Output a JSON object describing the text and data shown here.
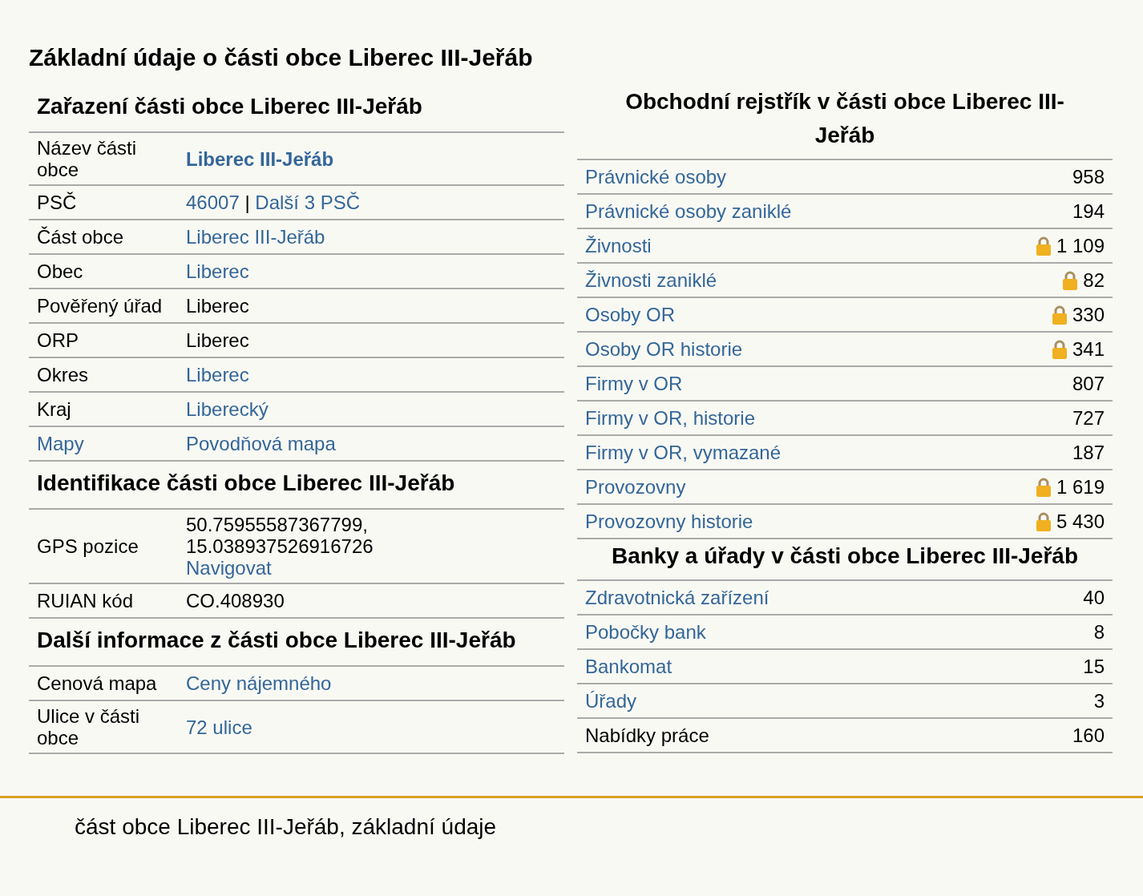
{
  "title": "Základní údaje o části obce Liberec III-Jeřáb",
  "left_sections": [
    {
      "title": "Zařazení části obce Liberec III-Jeřáb",
      "rows": [
        {
          "label": "Název části obce",
          "label_link": false,
          "lines": [
            [
              {
                "text": "Liberec III-Jeřáb",
                "link": true,
                "bold": true
              }
            ]
          ]
        },
        {
          "label": "PSČ",
          "label_link": false,
          "lines": [
            [
              {
                "text": "46007",
                "link": true,
                "bold": false
              },
              {
                "text": " | ",
                "link": false,
                "bold": false
              },
              {
                "text": "Další 3 PSČ",
                "link": true,
                "bold": false
              }
            ]
          ]
        },
        {
          "label": "Část obce",
          "label_link": false,
          "lines": [
            [
              {
                "text": "Liberec III-Jeřáb",
                "link": true,
                "bold": false
              }
            ]
          ]
        },
        {
          "label": "Obec",
          "label_link": false,
          "lines": [
            [
              {
                "text": "Liberec",
                "link": true,
                "bold": false
              }
            ]
          ]
        },
        {
          "label": "Pověřený úřad",
          "label_link": false,
          "lines": [
            [
              {
                "text": "Liberec",
                "link": false,
                "bold": false
              }
            ]
          ]
        },
        {
          "label": "ORP",
          "label_link": false,
          "lines": [
            [
              {
                "text": "Liberec",
                "link": false,
                "bold": false
              }
            ]
          ]
        },
        {
          "label": "Okres",
          "label_link": false,
          "lines": [
            [
              {
                "text": "Liberec",
                "link": true,
                "bold": false
              }
            ]
          ]
        },
        {
          "label": "Kraj",
          "label_link": false,
          "lines": [
            [
              {
                "text": "Liberecký",
                "link": true,
                "bold": false
              }
            ]
          ]
        },
        {
          "label": "Mapy",
          "label_link": true,
          "lines": [
            [
              {
                "text": "Povodňová mapa",
                "link": true,
                "bold": false
              }
            ]
          ]
        }
      ]
    },
    {
      "title": "Identifikace části obce Liberec III-Jeřáb",
      "rows": [
        {
          "label": "GPS pozice",
          "label_link": false,
          "lines": [
            [
              {
                "text": "50.75955587367799,",
                "link": false,
                "bold": false
              }
            ],
            [
              {
                "text": "15.038937526916726",
                "link": false,
                "bold": false
              }
            ],
            [
              {
                "text": "Navigovat",
                "link": true,
                "bold": false
              }
            ]
          ]
        },
        {
          "label": "RUIAN kód",
          "label_link": false,
          "lines": [
            [
              {
                "text": "CO.408930",
                "link": false,
                "bold": false
              }
            ]
          ]
        }
      ]
    },
    {
      "title": "Další informace z části obce Liberec III-Jeřáb",
      "rows": [
        {
          "label": "Cenová mapa",
          "label_link": false,
          "lines": [
            [
              {
                "text": "Ceny nájemného",
                "link": true,
                "bold": false
              }
            ]
          ]
        },
        {
          "label": "Ulice v části obce",
          "label_link": false,
          "lines": [
            [
              {
                "text": "72 ulice",
                "link": true,
                "bold": false
              }
            ]
          ]
        }
      ]
    }
  ],
  "right_sections": [
    {
      "title": "Obchodní rejstřík v části obce Liberec III-Jeřáb",
      "rows": [
        {
          "label": "Právnické osoby",
          "link": true,
          "count": "958",
          "locked": false
        },
        {
          "label": "Právnické osoby zaniklé",
          "link": true,
          "count": "194",
          "locked": false
        },
        {
          "label": "Živnosti",
          "link": true,
          "count": "1 109",
          "locked": true
        },
        {
          "label": "Živnosti zaniklé",
          "link": true,
          "count": "82",
          "locked": true
        },
        {
          "label": "Osoby OR",
          "link": true,
          "count": "330",
          "locked": true
        },
        {
          "label": "Osoby OR historie",
          "link": true,
          "count": "341",
          "locked": true
        },
        {
          "label": "Firmy v OR",
          "link": true,
          "count": "807",
          "locked": false
        },
        {
          "label": "Firmy v OR, historie",
          "link": true,
          "count": "727",
          "locked": false
        },
        {
          "label": "Firmy v OR, vymazané",
          "link": true,
          "count": "187",
          "locked": false
        },
        {
          "label": "Provozovny",
          "link": true,
          "count": "1 619",
          "locked": true
        },
        {
          "label": "Provozovny historie",
          "link": true,
          "count": "5 430",
          "locked": true
        }
      ]
    },
    {
      "title": "Banky a úřady v části obce Liberec III-Jeřáb",
      "rows": [
        {
          "label": "Zdravotnická zařízení",
          "link": true,
          "count": "40",
          "locked": false
        },
        {
          "label": "Pobočky bank",
          "link": true,
          "count": "8",
          "locked": false
        },
        {
          "label": "Bankomat",
          "link": true,
          "count": "15",
          "locked": false
        },
        {
          "label": "Úřady",
          "link": true,
          "count": "3",
          "locked": false
        },
        {
          "label": "Nabídky práce",
          "link": false,
          "count": "160",
          "locked": false
        }
      ]
    }
  ],
  "footer": "část obce Liberec III-Jeřáb, základní údaje"
}
